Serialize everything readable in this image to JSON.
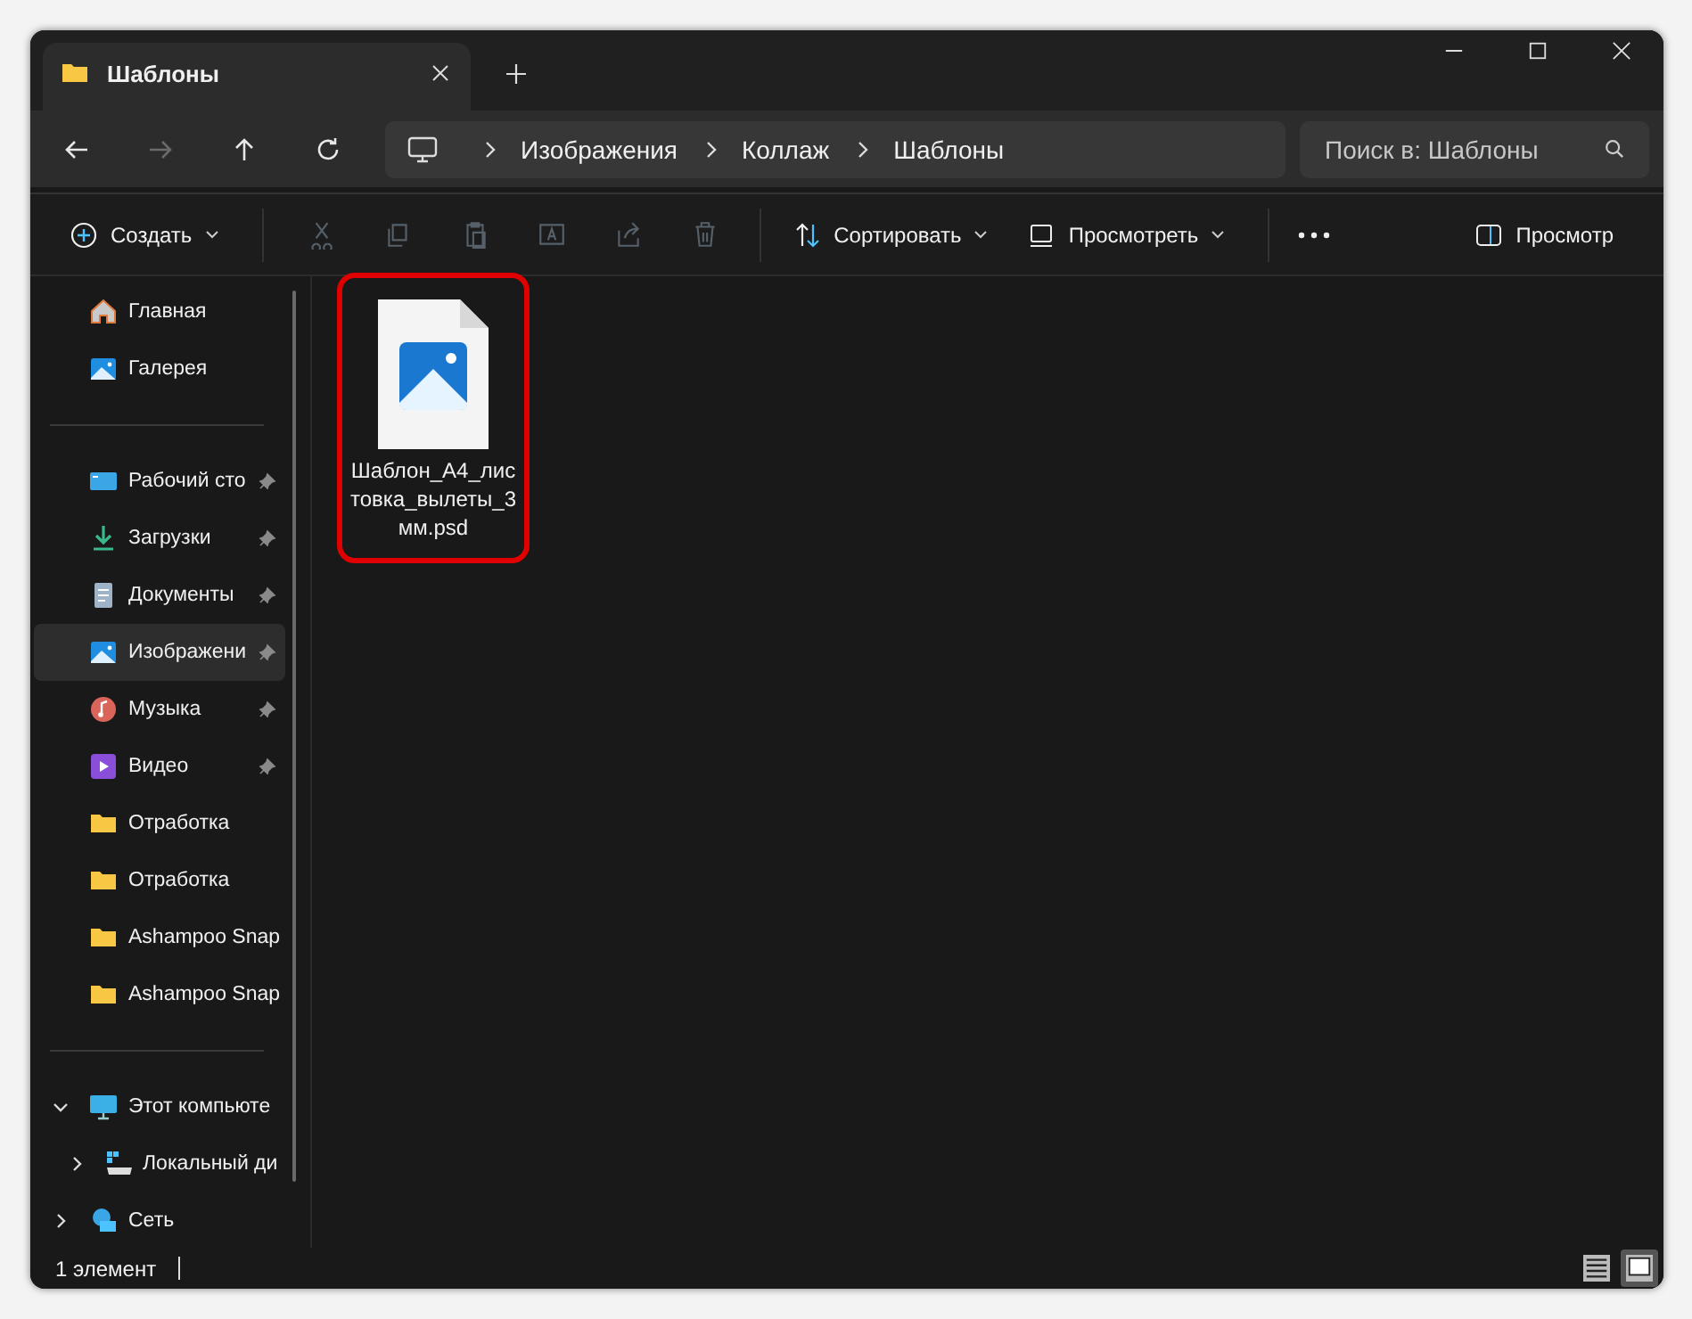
{
  "window": {
    "tab_title": "Шаблоны"
  },
  "navigation": {
    "buttons": [
      {
        "kind": "back",
        "disabled": false
      },
      {
        "kind": "forward",
        "disabled": true
      },
      {
        "kind": "up",
        "disabled": false
      },
      {
        "kind": "refresh",
        "disabled": false
      }
    ],
    "breadcrumbs": [
      "Изображения",
      "Коллаж",
      "Шаблоны"
    ],
    "search": {
      "placeholder": "Поиск в: Шаблоны"
    }
  },
  "toolbar": {
    "new_label": "Создать",
    "actions": [
      {
        "kind": "cut",
        "disabled": true
      },
      {
        "kind": "copy",
        "disabled": true
      },
      {
        "kind": "paste",
        "disabled": true
      },
      {
        "kind": "rename",
        "disabled": true
      },
      {
        "kind": "share",
        "disabled": true
      },
      {
        "kind": "delete",
        "disabled": true
      }
    ],
    "sort_label": "Сортировать",
    "view_label": "Просмотреть",
    "preview_label": "Просмотр"
  },
  "sidebar": {
    "groups": [
      {
        "items": [
          {
            "label": "Главная",
            "kind": "home",
            "pinned": false,
            "selected": false
          },
          {
            "label": "Галерея",
            "kind": "gallery",
            "pinned": false,
            "selected": false
          }
        ]
      },
      {
        "items": [
          {
            "label": "Рабочий сто",
            "kind": "desktop",
            "pinned": true,
            "selected": false
          },
          {
            "label": "Загрузки",
            "kind": "downloads",
            "pinned": true,
            "selected": false
          },
          {
            "label": "Документы",
            "kind": "documents",
            "pinned": true,
            "selected": false
          },
          {
            "label": "Изображени",
            "kind": "pictures",
            "pinned": true,
            "selected": true
          },
          {
            "label": "Музыка",
            "kind": "music",
            "pinned": true,
            "selected": false
          },
          {
            "label": "Видео",
            "kind": "video",
            "pinned": true,
            "selected": false
          },
          {
            "label": "Отработка",
            "kind": "folder",
            "pinned": false,
            "selected": false
          },
          {
            "label": "Отработка",
            "kind": "folder",
            "pinned": false,
            "selected": false
          },
          {
            "label": "Ashampoo Snap",
            "kind": "folder",
            "pinned": false,
            "selected": false
          },
          {
            "label": "Ashampoo Snap",
            "kind": "folder",
            "pinned": false,
            "selected": false
          }
        ]
      },
      {
        "items": [
          {
            "label": "Этот компьюте",
            "kind": "pc",
            "expanded": true,
            "selected": false,
            "children": [
              {
                "label": "Локальный ди",
                "kind": "drive",
                "expanded": false,
                "selected": false
              }
            ]
          },
          {
            "label": "Сеть",
            "kind": "network",
            "expanded": false,
            "selected": false
          }
        ]
      }
    ]
  },
  "files": [
    {
      "name": "Шаблон_А4_листовка_вылеты_3мм.psd",
      "kind": "image",
      "highlighted": true
    }
  ],
  "status_bar": {
    "count": "1 элемент",
    "views": [
      {
        "kind": "details",
        "selected": false
      },
      {
        "kind": "tiles",
        "selected": true
      }
    ]
  }
}
